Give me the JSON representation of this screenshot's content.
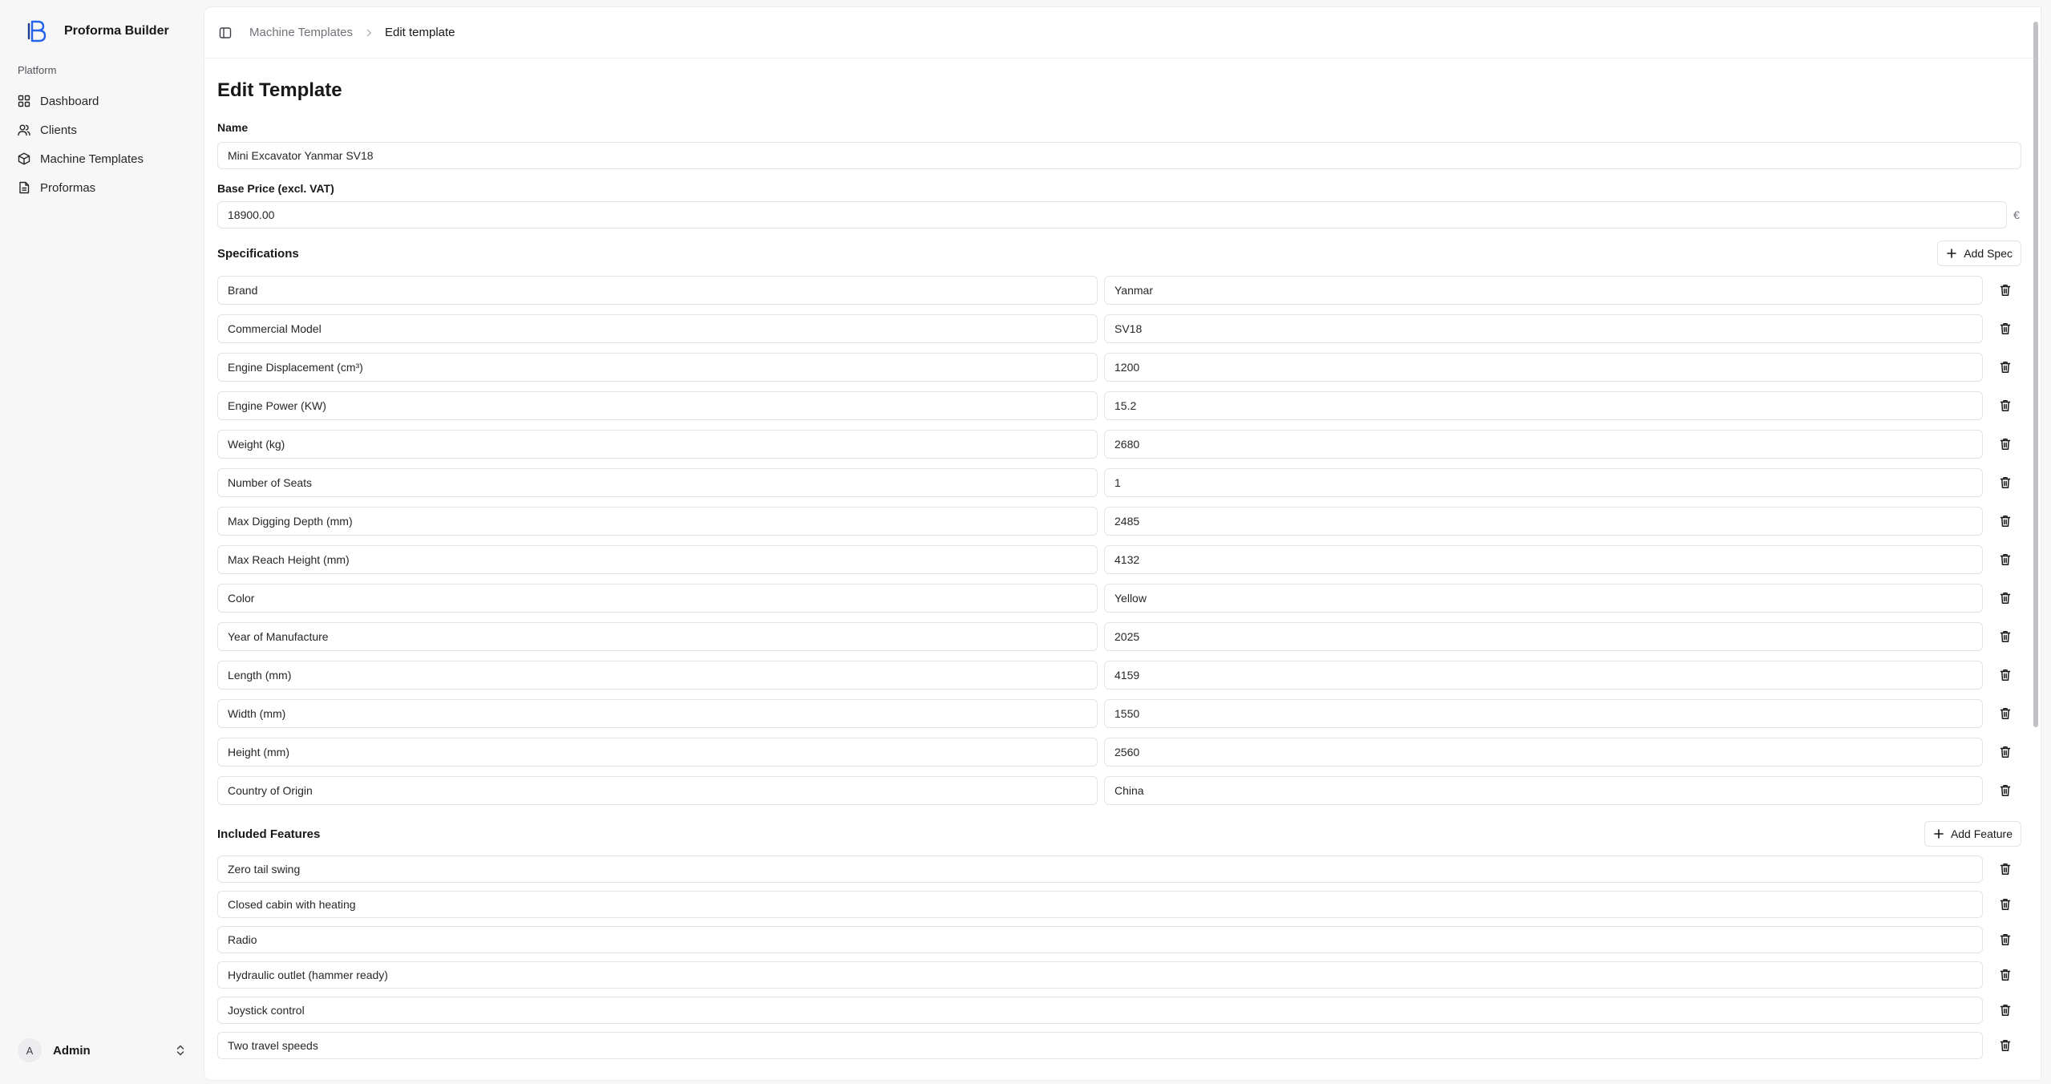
{
  "app": {
    "name": "Proforma Builder"
  },
  "sidebar": {
    "section": "Platform",
    "items": [
      {
        "label": "Dashboard",
        "icon": "grid-icon"
      },
      {
        "label": "Clients",
        "icon": "users-icon"
      },
      {
        "label": "Machine Templates",
        "icon": "box-icon"
      },
      {
        "label": "Proformas",
        "icon": "document-icon"
      }
    ],
    "user": {
      "initial": "A",
      "name": "Admin"
    }
  },
  "breadcrumb": {
    "parent": "Machine Templates",
    "current": "Edit template"
  },
  "form": {
    "title": "Edit Template",
    "name_label": "Name",
    "name_value": "Mini Excavator Yanmar SV18",
    "price_label": "Base Price (excl. VAT)",
    "price_value": "18900.00",
    "currency": "€",
    "specs_title": "Specifications",
    "add_spec_label": "Add Spec",
    "specs": [
      {
        "key": "Brand",
        "value": "Yanmar"
      },
      {
        "key": "Commercial Model",
        "value": "SV18"
      },
      {
        "key": "Engine Displacement (cm³)",
        "value": "1200"
      },
      {
        "key": "Engine Power (KW)",
        "value": "15.2"
      },
      {
        "key": "Weight (kg)",
        "value": "2680"
      },
      {
        "key": "Number of Seats",
        "value": "1"
      },
      {
        "key": "Max Digging Depth (mm)",
        "value": "2485"
      },
      {
        "key": "Max Reach Height (mm)",
        "value": "4132"
      },
      {
        "key": "Color",
        "value": "Yellow"
      },
      {
        "key": "Year of Manufacture",
        "value": "2025"
      },
      {
        "key": "Length (mm)",
        "value": "4159"
      },
      {
        "key": "Width (mm)",
        "value": "1550"
      },
      {
        "key": "Height (mm)",
        "value": "2560"
      },
      {
        "key": "Country of Origin",
        "value": "China"
      }
    ],
    "features_title": "Included Features",
    "add_feature_label": "Add Feature",
    "features": [
      "Zero tail swing",
      "Closed cabin with heating",
      "Radio",
      "Hydraulic outlet (hammer ready)",
      "Joystick control",
      "Two travel speeds"
    ]
  },
  "colors": {
    "brand": "#2563eb",
    "border": "#e4e4e7",
    "sidebar_bg": "#f7f7f8"
  }
}
